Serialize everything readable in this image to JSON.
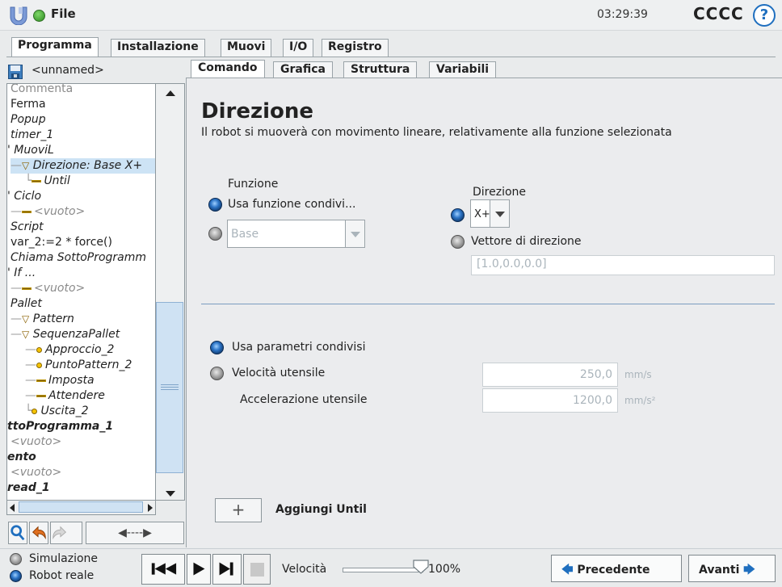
{
  "header": {
    "file_label": "File",
    "clock": "03:29:39",
    "robot_name": "CCCC",
    "help": "?"
  },
  "main_tabs": [
    "Programma",
    "Installazione",
    "Muovi",
    "I/O",
    "Registro"
  ],
  "program": {
    "name": "<unnamed>"
  },
  "tree": [
    {
      "text": "Commenta"
    },
    {
      "text": "Ferma"
    },
    {
      "text": "Popup"
    },
    {
      "text": "timer_1"
    },
    {
      "text": "' MuoviL"
    },
    {
      "text": "Direzione: Base X+"
    },
    {
      "text": "Until"
    },
    {
      "text": "' Ciclo"
    },
    {
      "text": "<vuoto>"
    },
    {
      "text": "Script"
    },
    {
      "text": "var_2:=2 * force()"
    },
    {
      "text": "Chiama SottoProgramm"
    },
    {
      "text": "' If ..."
    },
    {
      "text": "<vuoto>"
    },
    {
      "text": "Pallet"
    },
    {
      "text": "Pattern"
    },
    {
      "text": "SequenzaPallet"
    },
    {
      "text": "Approccio_2"
    },
    {
      "text": "PuntoPattern_2"
    },
    {
      "text": "Imposta"
    },
    {
      "text": "Attendere"
    },
    {
      "text": "Uscita_2"
    },
    {
      "text": "ttoProgramma_1"
    },
    {
      "text": "<vuoto>"
    },
    {
      "text": "ento"
    },
    {
      "text": "<vuoto>"
    },
    {
      "text": "read_1"
    }
  ],
  "tree_tools": {
    "nav_arrow": "◀----▶"
  },
  "sub_tabs": [
    "Comando",
    "Grafica",
    "Struttura",
    "Variabili"
  ],
  "command": {
    "title": "Direzione",
    "description": "Il robot si muoverà con movimento lineare, relativamente alla funzione selezionata",
    "funzione_label": "Funzione",
    "use_shared_feature": "Usa funzione condivi...",
    "feature_value": "Base",
    "direzione_label": "Direzione",
    "direction_value": "X+",
    "vector_label": "Vettore di direzione",
    "vector_value": "[1.0,0.0,0.0]",
    "use_shared_params": "Usa parametri condivisi",
    "tool_speed_label": "Velocità utensile",
    "tool_speed_value": "250,0",
    "tool_speed_unit": "mm/s",
    "tool_accel_label": "Accelerazione utensile",
    "tool_accel_value": "1200,0",
    "tool_accel_unit": "mm/s²",
    "add_until_icon": "+",
    "add_until_label": "Aggiungi Until"
  },
  "footer": {
    "simulation": "Simulazione",
    "real_robot": "Robot reale",
    "speed_label": "Velocità",
    "speed_value": "100%",
    "speed_fraction": 1.0,
    "prev": "Precedente",
    "next": "Avanti"
  },
  "colors": {
    "accent": "#1f6fbf",
    "status_green": "#2b8a1e"
  }
}
